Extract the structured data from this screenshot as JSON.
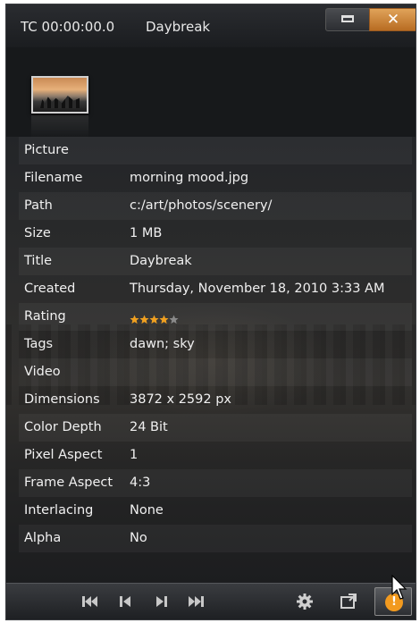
{
  "window": {
    "timecode": "TC 00:00:00.0",
    "title": "Daybreak",
    "close_glyph": "✕"
  },
  "properties": [
    {
      "key": "Picture",
      "value": "",
      "section": true
    },
    {
      "key": "Filename",
      "value": "morning mood.jpg"
    },
    {
      "key": "Path",
      "value": "c:/art/photos/scenery/"
    },
    {
      "key": "Size",
      "value": "1 MB"
    },
    {
      "key": "Title",
      "value": "Daybreak"
    },
    {
      "key": "Created",
      "value": "Thursday, November 18, 2010 3:33 AM"
    },
    {
      "key": "Rating",
      "value": ""
    },
    {
      "key": "Tags",
      "value": "dawn; sky"
    },
    {
      "key": "Video",
      "value": "",
      "section": true
    },
    {
      "key": "Dimensions",
      "value": "3872 x 2592 px"
    },
    {
      "key": "Color Depth",
      "value": "24 Bit"
    },
    {
      "key": "Pixel Aspect",
      "value": "1"
    },
    {
      "key": "Frame Aspect",
      "value": "4:3"
    },
    {
      "key": "Interlacing",
      "value": "None"
    },
    {
      "key": "Alpha",
      "value": "No"
    }
  ],
  "rating": {
    "stars": 4,
    "max": 5,
    "filled_color": "#f0a020",
    "empty_color": "#8a8a8a"
  },
  "footer": {
    "transport_icons": [
      "skip-to-start-icon",
      "previous-frame-icon",
      "next-frame-icon",
      "skip-to-end-icon"
    ],
    "settings_icon": "gear-icon",
    "export_icon": "external-window-icon",
    "info_glyph": "!"
  },
  "colors": {
    "accent": "#f29a1f",
    "close_button": "#d08a3e",
    "background": "#17191b"
  }
}
